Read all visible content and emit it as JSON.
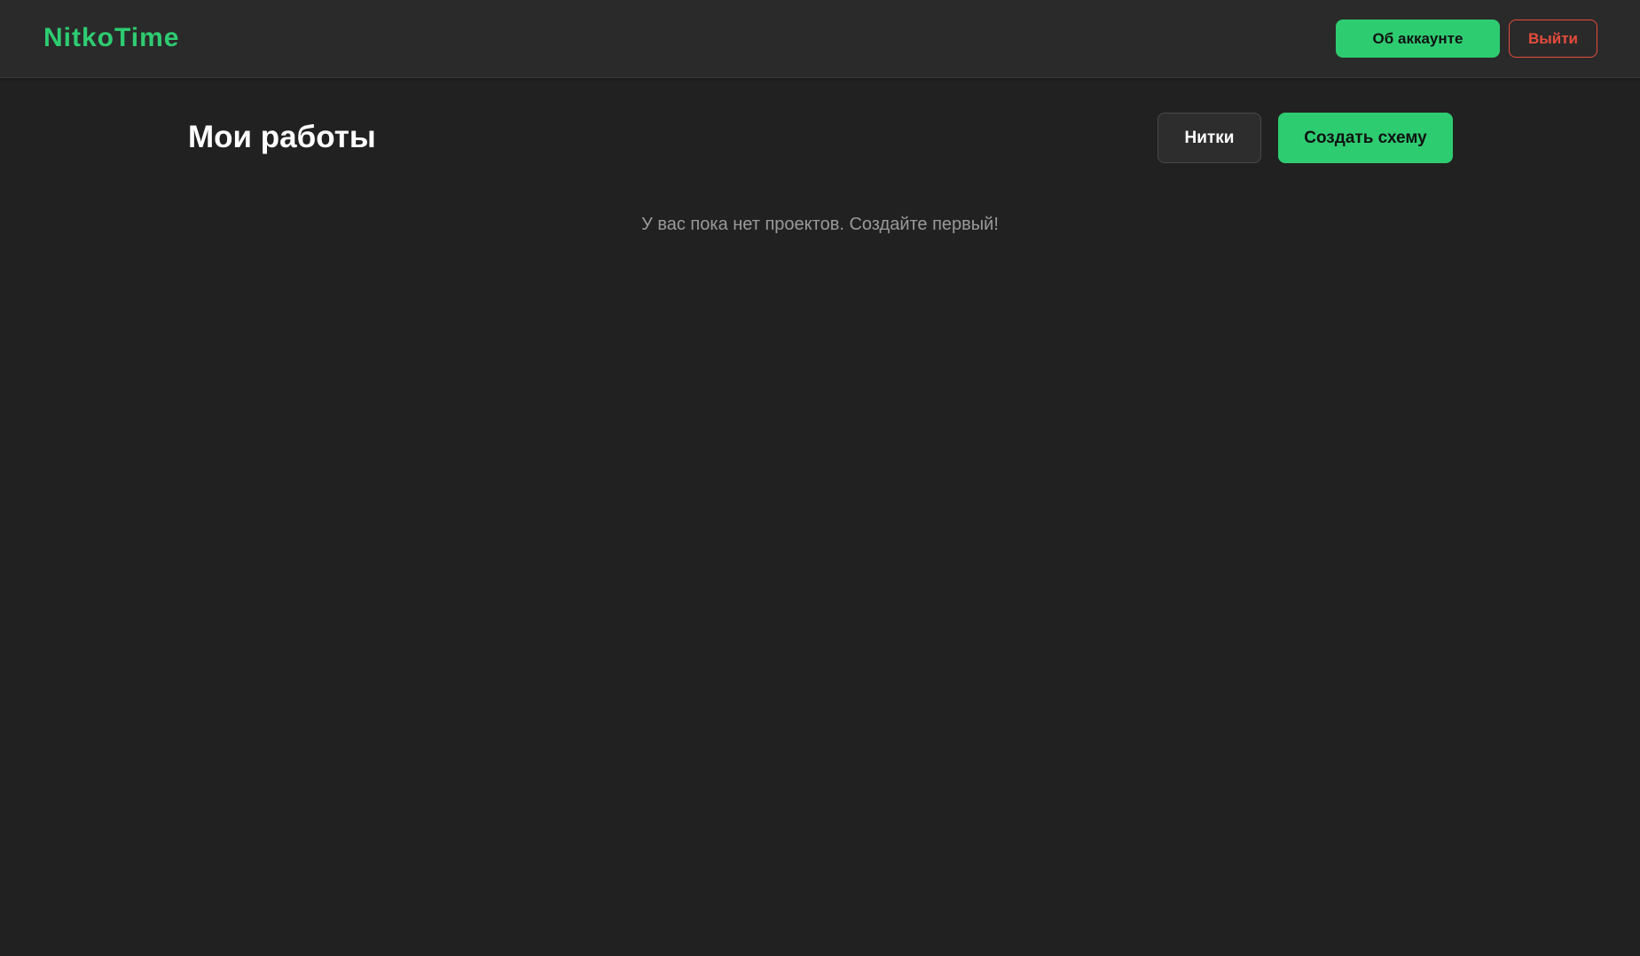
{
  "header": {
    "logo": "NitkoTime",
    "account_label": "Об аккаунте",
    "logout_label": "Выйти"
  },
  "main": {
    "title": "Мои работы",
    "threads_label": "Нитки",
    "create_label": "Создать схему",
    "empty_message": "У вас пока нет проектов. Создайте первый!"
  },
  "colors": {
    "accent": "#2ecc71",
    "danger": "#e74c3c",
    "background": "#212121",
    "header_background": "#2a2a2a"
  }
}
